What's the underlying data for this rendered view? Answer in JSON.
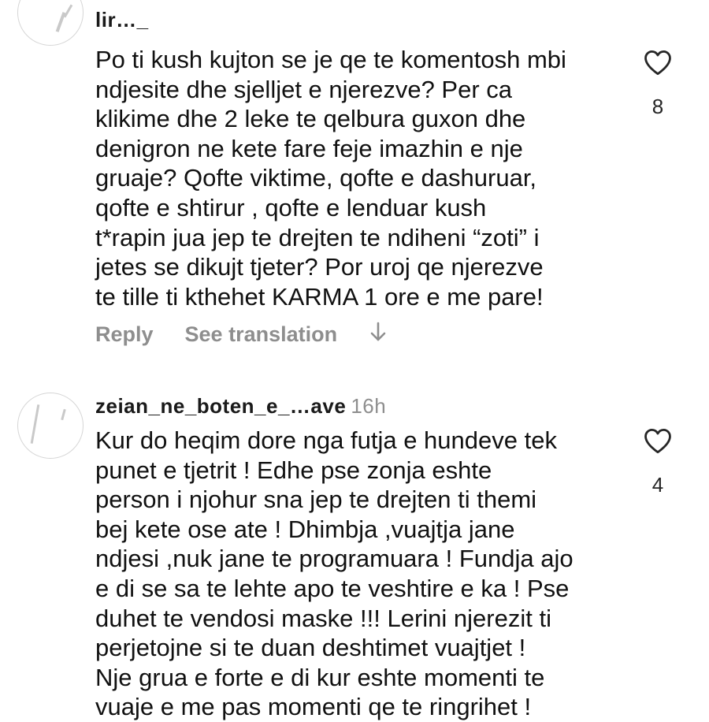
{
  "comments": [
    {
      "username": "lir…_",
      "time": "",
      "lines": [
        "Po ti kush kujton se je qe te komentosh mbi",
        "ndjesite dhe sjelljet e njerezve? Per ca",
        "klikime dhe 2 leke te qelbura guxon dhe",
        "denigron ne kete fare feje imazhin e nje",
        "gruaje? Qofte viktime, qofte e dashuruar,",
        "qofte e shtirur , qofte e lenduar kush",
        "t*rapin jua jep te drejten te ndiheni “zoti” i",
        "jetes se dikujt tjeter? Por uroj qe njerezve",
        "te tille ti kthehet KARMA 1 ore e me pare!"
      ],
      "like_count": "8",
      "reply_label": "Reply",
      "translate_label": "See translation",
      "more_icon": "arrow-down-icon"
    },
    {
      "username": "zeian_ne_boten_e_…ave",
      "time": "16h",
      "lines": [
        "Kur do heqim dore nga futja e hundeve tek",
        "punet e tjetrit ! Edhe pse zonja eshte",
        "person i njohur sna jep te drejten ti themi",
        "bej kete ose ate ! Dhimbja ,vuajtja jane",
        "ndjesi ,nuk jane te programuara ! Fundja ajo",
        "e di se sa te lehte apo te veshtire e ka ! Pse",
        "duhet te vendosi maske !!! Lerini njerezit ti",
        "perjetojne si te duan deshtimet vuajtjet !",
        "Nje grua e forte e di kur eshte momenti te",
        "vuaje e me pas momenti qe te ringrihet !"
      ],
      "like_count": "4"
    }
  ],
  "colors": {
    "text": "#111111",
    "muted": "#8e8e8e",
    "background": "#ffffff"
  }
}
